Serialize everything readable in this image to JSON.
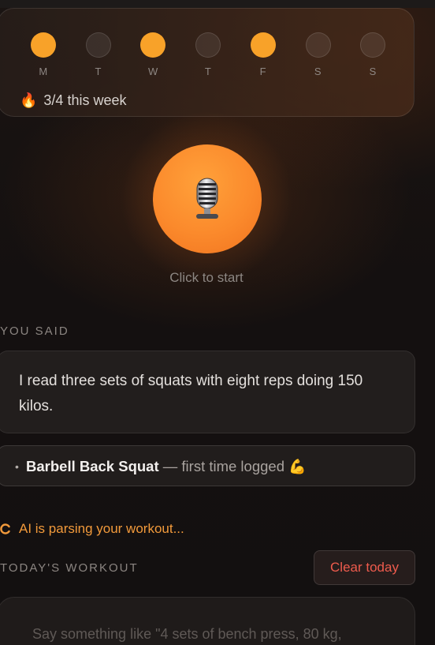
{
  "week": {
    "days": [
      {
        "label": "M",
        "active": true
      },
      {
        "label": "T",
        "active": false
      },
      {
        "label": "W",
        "active": true
      },
      {
        "label": "T",
        "active": false
      },
      {
        "label": "F",
        "active": true
      },
      {
        "label": "S",
        "active": false
      },
      {
        "label": "S",
        "active": false
      }
    ],
    "streak_icon": "fire-icon",
    "streak_text": "3/4 this week"
  },
  "recorder": {
    "icon": "microphone-icon",
    "hint": "Click to start"
  },
  "you_said": {
    "label": "YOU SAID",
    "text": "I read three sets of squats with eight reps doing 150 kilos."
  },
  "detected": {
    "bullet": "•",
    "exercise_name": "Barbell Back Squat",
    "note": " — first time logged ",
    "icon": "flexed-biceps-icon"
  },
  "status": {
    "icon": "spinner-icon",
    "text": "AI is parsing your workout..."
  },
  "today": {
    "label": "TODAY'S WORKOUT",
    "clear_label": "Clear today",
    "placeholder": "Say something like \"4 sets of bench press, 80 kg,"
  },
  "colors": {
    "accent": "#f8a229",
    "danger": "#ee5b4d",
    "status": "#f29a3b"
  }
}
